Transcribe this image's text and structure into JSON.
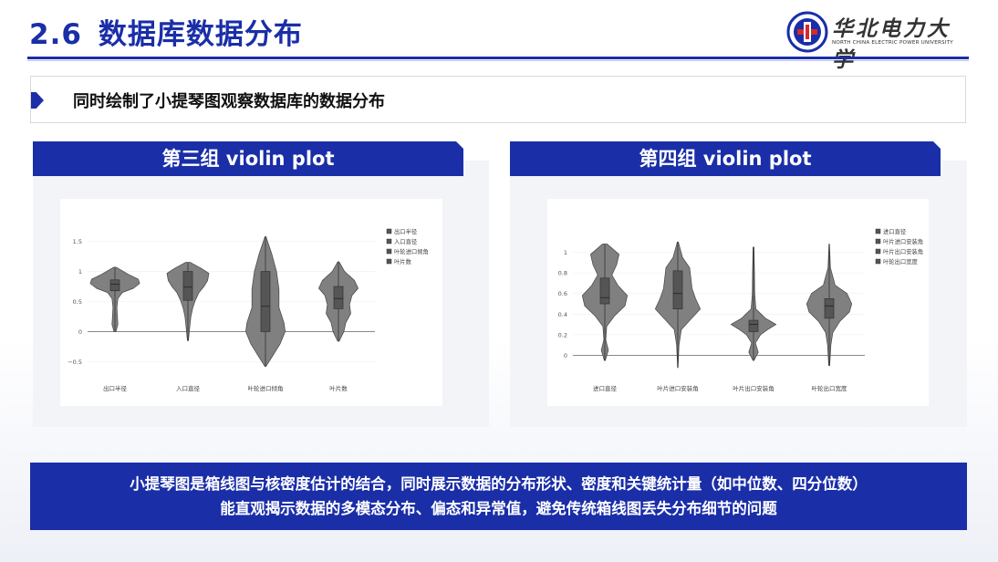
{
  "slide": {
    "number": "2.6",
    "title": "数据库数据分布",
    "subtitle": "同时绘制了小提琴图观察数据库的数据分布",
    "logo": {
      "name_cn": "华北电力大学",
      "name_en": "NORTH CHINA ELECTRIC POWER UNIVERSITY"
    },
    "footer_line1": "小提琴图是箱线图与核密度估计的结合，同时展示数据的分布形状、密度和关键统计量（如中位数、四分位数）",
    "footer_line2": "能直观揭示数据的多模态分布、偏态和异常值，避免传统箱线图丢失分布细节的问题",
    "colors": {
      "accent": "#1a2ea8",
      "violin_fill": "#808080",
      "box_fill": "#555555"
    }
  },
  "panels": [
    {
      "title": "第三组 violin plot"
    },
    {
      "title": "第四组 violin plot"
    }
  ],
  "chart_data": [
    {
      "type": "violin",
      "categories": [
        "出口半径",
        "入口直径",
        "叶轮进口倾角",
        "叶片数"
      ],
      "legend": [
        "出口半径",
        "入口直径",
        "叶轮进口倾角",
        "叶片数"
      ],
      "y_ticks": [
        "1.5",
        "1",
        "0.5",
        "0",
        "−0.5"
      ],
      "ylim": [
        -0.6,
        1.6
      ],
      "legend_position": "top-right",
      "series": [
        {
          "name": "出口半径",
          "min": 0.0,
          "max": 1.07,
          "q1": 0.68,
          "median": 0.79,
          "q3": 0.86,
          "density": [
            [
              1.07,
              0.05
            ],
            [
              0.95,
              0.55
            ],
            [
              0.87,
              0.95
            ],
            [
              0.8,
              1.0
            ],
            [
              0.72,
              0.75
            ],
            [
              0.65,
              0.3
            ],
            [
              0.55,
              0.12
            ],
            [
              0.4,
              0.08
            ],
            [
              0.25,
              0.1
            ],
            [
              0.12,
              0.12
            ],
            [
              0.0,
              0.04
            ]
          ]
        },
        {
          "name": "入口直径",
          "min": -0.15,
          "max": 1.15,
          "q1": 0.52,
          "median": 0.74,
          "q3": 1.0,
          "density": [
            [
              1.15,
              0.1
            ],
            [
              1.05,
              0.55
            ],
            [
              0.97,
              0.85
            ],
            [
              0.85,
              0.8
            ],
            [
              0.75,
              0.65
            ],
            [
              0.65,
              0.45
            ],
            [
              0.52,
              0.3
            ],
            [
              0.4,
              0.2
            ],
            [
              0.25,
              0.12
            ],
            [
              0.1,
              0.08
            ],
            [
              -0.15,
              0.02
            ]
          ]
        },
        {
          "name": "叶轮进口倾角",
          "min": -0.58,
          "max": 1.58,
          "q1": 0.0,
          "median": 0.42,
          "q3": 1.0,
          "density": [
            [
              1.58,
              0.02
            ],
            [
              1.3,
              0.25
            ],
            [
              1.0,
              0.45
            ],
            [
              0.7,
              0.55
            ],
            [
              0.4,
              0.55
            ],
            [
              0.15,
              0.75
            ],
            [
              0.0,
              0.8
            ],
            [
              -0.2,
              0.6
            ],
            [
              -0.4,
              0.3
            ],
            [
              -0.58,
              0.02
            ]
          ]
        },
        {
          "name": "叶片数",
          "min": -0.16,
          "max": 1.16,
          "q1": 0.38,
          "median": 0.55,
          "q3": 0.75,
          "density": [
            [
              1.16,
              0.03
            ],
            [
              1.0,
              0.25
            ],
            [
              0.85,
              0.65
            ],
            [
              0.72,
              0.8
            ],
            [
              0.6,
              0.55
            ],
            [
              0.45,
              0.45
            ],
            [
              0.3,
              0.5
            ],
            [
              0.15,
              0.3
            ],
            [
              0.0,
              0.22
            ],
            [
              -0.16,
              0.03
            ]
          ]
        }
      ]
    },
    {
      "type": "violin",
      "categories": [
        "进口直径",
        "叶片进口安装角",
        "叶片出口安装角",
        "叶轮出口宽度"
      ],
      "legend": [
        "进口直径",
        "叶片进口安装角",
        "叶片出口安装角",
        "叶轮出口宽度"
      ],
      "y_ticks": [
        "1",
        "0.8",
        "0.6",
        "0.4",
        "0.2",
        "0"
      ],
      "ylim": [
        -0.12,
        1.12
      ],
      "legend_position": "top-right",
      "series": [
        {
          "name": "进口直径",
          "min": -0.05,
          "max": 1.08,
          "q1": 0.5,
          "median": 0.56,
          "q3": 0.75,
          "density": [
            [
              1.08,
              0.1
            ],
            [
              0.98,
              0.6
            ],
            [
              0.88,
              0.5
            ],
            [
              0.78,
              0.3
            ],
            [
              0.68,
              0.55
            ],
            [
              0.58,
              0.95
            ],
            [
              0.48,
              0.85
            ],
            [
              0.38,
              0.4
            ],
            [
              0.28,
              0.08
            ],
            [
              0.15,
              0.04
            ],
            [
              0.05,
              0.15
            ],
            [
              -0.05,
              0.02
            ]
          ]
        },
        {
          "name": "叶片进口安装角",
          "min": -0.12,
          "max": 1.1,
          "q1": 0.45,
          "median": 0.6,
          "q3": 0.82,
          "density": [
            [
              1.1,
              0.02
            ],
            [
              0.95,
              0.2
            ],
            [
              0.85,
              0.5
            ],
            [
              0.75,
              0.55
            ],
            [
              0.65,
              0.6
            ],
            [
              0.55,
              0.75
            ],
            [
              0.45,
              0.95
            ],
            [
              0.35,
              0.55
            ],
            [
              0.25,
              0.15
            ],
            [
              0.1,
              0.05
            ],
            [
              -0.12,
              0.01
            ]
          ]
        },
        {
          "name": "叶片出口安装角",
          "min": -0.05,
          "max": 1.05,
          "q1": 0.23,
          "median": 0.3,
          "q3": 0.34,
          "density": [
            [
              1.05,
              0.02
            ],
            [
              0.8,
              0.04
            ],
            [
              0.6,
              0.05
            ],
            [
              0.45,
              0.1
            ],
            [
              0.36,
              0.5
            ],
            [
              0.3,
              0.95
            ],
            [
              0.25,
              0.6
            ],
            [
              0.2,
              0.3
            ],
            [
              0.12,
              0.08
            ],
            [
              0.03,
              0.2
            ],
            [
              -0.05,
              0.02
            ]
          ]
        },
        {
          "name": "叶轮出口宽度",
          "min": -0.1,
          "max": 1.08,
          "q1": 0.36,
          "median": 0.48,
          "q3": 0.55,
          "density": [
            [
              1.08,
              0.01
            ],
            [
              0.85,
              0.05
            ],
            [
              0.68,
              0.25
            ],
            [
              0.6,
              0.75
            ],
            [
              0.5,
              0.95
            ],
            [
              0.42,
              0.85
            ],
            [
              0.33,
              0.45
            ],
            [
              0.22,
              0.15
            ],
            [
              0.1,
              0.07
            ],
            [
              -0.1,
              0.02
            ]
          ]
        }
      ]
    }
  ]
}
